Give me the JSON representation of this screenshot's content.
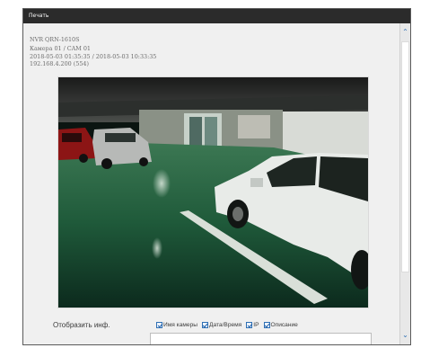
{
  "window": {
    "title": "Печать"
  },
  "info": {
    "model": "NVR QRN-1610S",
    "camera": "Камера 01 / CAM 01",
    "time_range": "2018-05-03 01:35:35 / 2018-05-03 10:33:35",
    "ip": "192.168.4.200 (554)"
  },
  "options": {
    "label": "Отобразить инф.",
    "checkboxes": [
      {
        "label": "Имя камеры",
        "checked": true
      },
      {
        "label": "Дата/Время",
        "checked": true
      },
      {
        "label": "IP",
        "checked": true
      },
      {
        "label": "Описание",
        "checked": true
      }
    ]
  },
  "description": {
    "value": ""
  },
  "icons": {
    "scroll_up": "chevron-up-icon",
    "scroll_down": "chevron-down-icon"
  },
  "colors": {
    "titlebar": "#2b2b2b",
    "accent": "#2e6fb4"
  }
}
